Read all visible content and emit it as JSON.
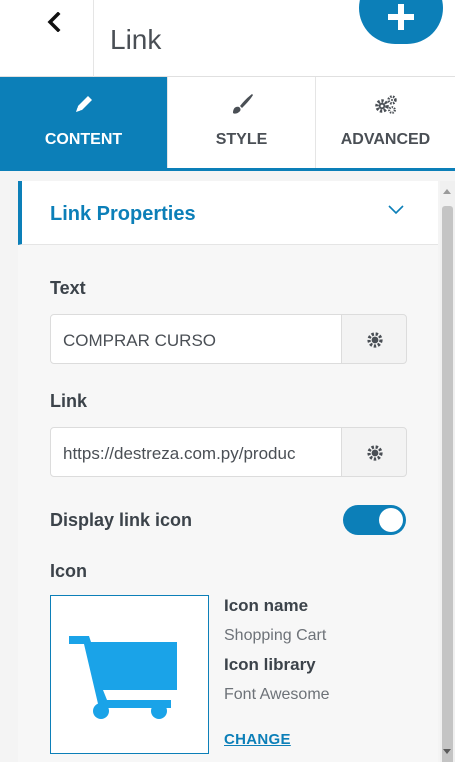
{
  "header": {
    "title": "Link",
    "back_icon": "chevron-left-icon",
    "add_icon": "plus-icon"
  },
  "tabs": [
    {
      "label": "CONTENT",
      "icon": "pencil-icon",
      "active": true
    },
    {
      "label": "STYLE",
      "icon": "brush-icon",
      "active": false
    },
    {
      "label": "ADVANCED",
      "icon": "gears-icon",
      "active": false
    }
  ],
  "section": {
    "title": "Link Properties",
    "expanded": true
  },
  "fields": {
    "text": {
      "label": "Text",
      "value": "COMPRAR CURSO"
    },
    "link": {
      "label": "Link",
      "value": "https://destreza.com.py/produc"
    },
    "display_icon": {
      "label": "Display link icon",
      "enabled": true
    }
  },
  "icon": {
    "label": "Icon",
    "name_label": "Icon name",
    "name_value": "Shopping Cart",
    "library_label": "Icon library",
    "library_value": "Font Awesome",
    "change_label": "CHANGE",
    "preview_icon": "shopping-cart-icon"
  },
  "colors": {
    "accent": "#0c7fb8",
    "cart_icon": "#1aa3e8",
    "text": "#3c434a"
  }
}
